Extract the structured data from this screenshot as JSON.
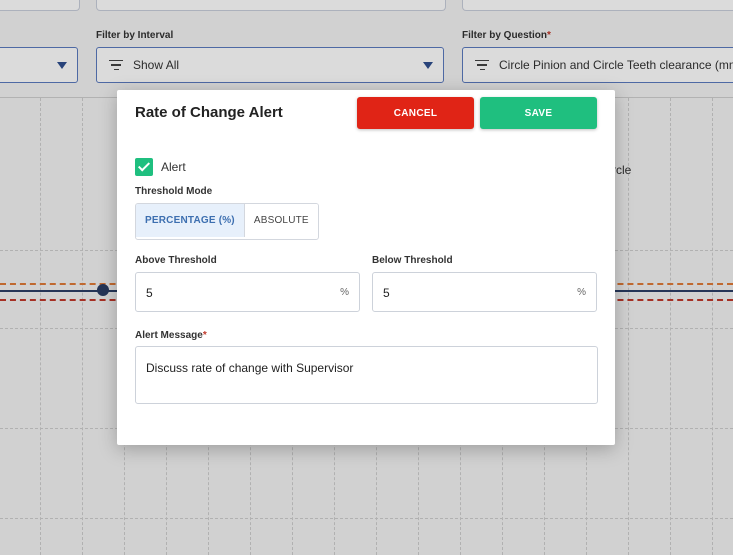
{
  "filters": {
    "interval": {
      "label": "Filter by Interval",
      "value": "Show All",
      "icon": "filter-icon"
    },
    "question": {
      "label": "Filter by Question",
      "required_mark": "*",
      "value": "Circle Pinion and Circle Teeth clearance (mm",
      "icon": "filter-icon"
    }
  },
  "background": {
    "partial_text": "rcle"
  },
  "modal": {
    "title": "Rate of Change Alert",
    "cancel_label": "CANCEL",
    "save_label": "SAVE",
    "alert_checkbox": {
      "label": "Alert",
      "checked": true
    },
    "threshold_mode": {
      "label": "Threshold Mode",
      "options": [
        "PERCENTAGE (%)",
        "ABSOLUTE"
      ],
      "selected": "PERCENTAGE (%)"
    },
    "above_threshold": {
      "label": "Above Threshold",
      "value": "5",
      "unit": "%"
    },
    "below_threshold": {
      "label": "Below Threshold",
      "value": "5",
      "unit": "%"
    },
    "alert_message": {
      "label": "Alert Message",
      "required_mark": "*",
      "value": "Discuss rate of change with Supervisor"
    }
  },
  "colors": {
    "cancel": "#e02416",
    "save": "#1fbf7f",
    "accent": "#3d6fb0"
  }
}
